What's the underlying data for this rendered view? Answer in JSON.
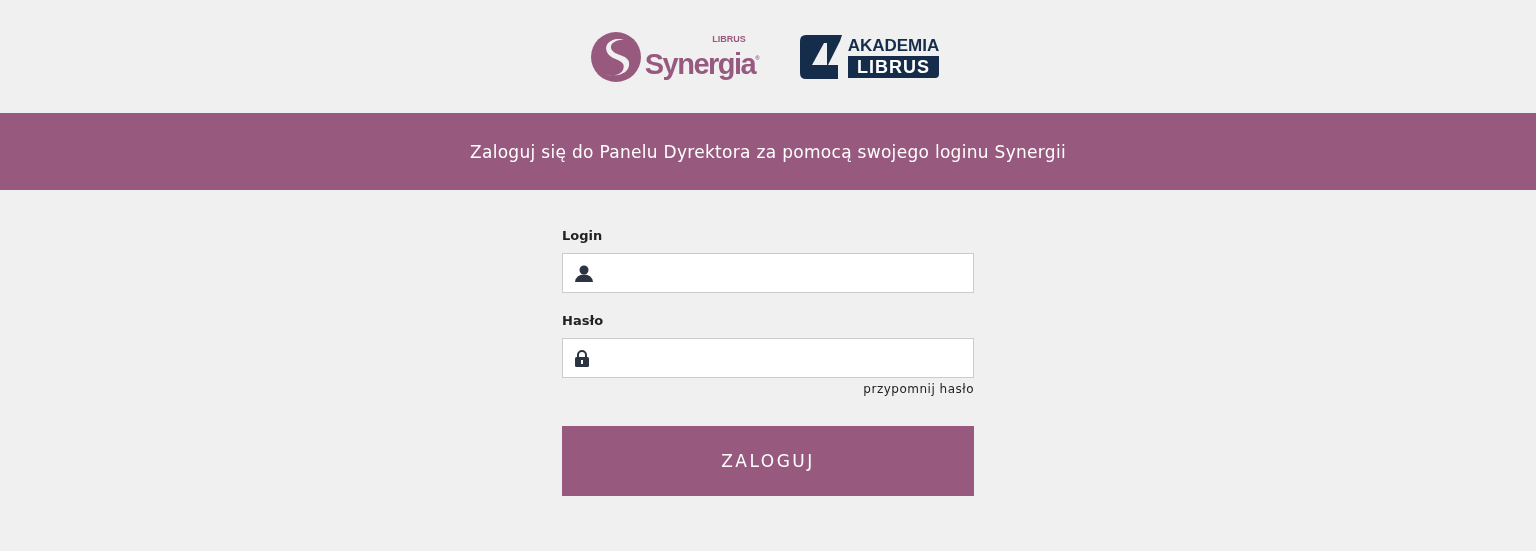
{
  "logos": {
    "synergia": {
      "brand": "LIBRUS",
      "name": "Synergia",
      "mark": "®"
    },
    "akademia": {
      "line_1": "AKADEMIA",
      "line_2": "LIBRUS"
    }
  },
  "banner": {
    "text": "Zaloguj się do Panelu Dyrektora za pomocą swojego loginu Synergii"
  },
  "form": {
    "fields": [
      {
        "label": "Login",
        "kind": "user"
      },
      {
        "label": "Hasło",
        "kind": "password"
      }
    ],
    "forgot_link": "przypomnij hasło",
    "submit": "ZALOGUJ"
  }
}
